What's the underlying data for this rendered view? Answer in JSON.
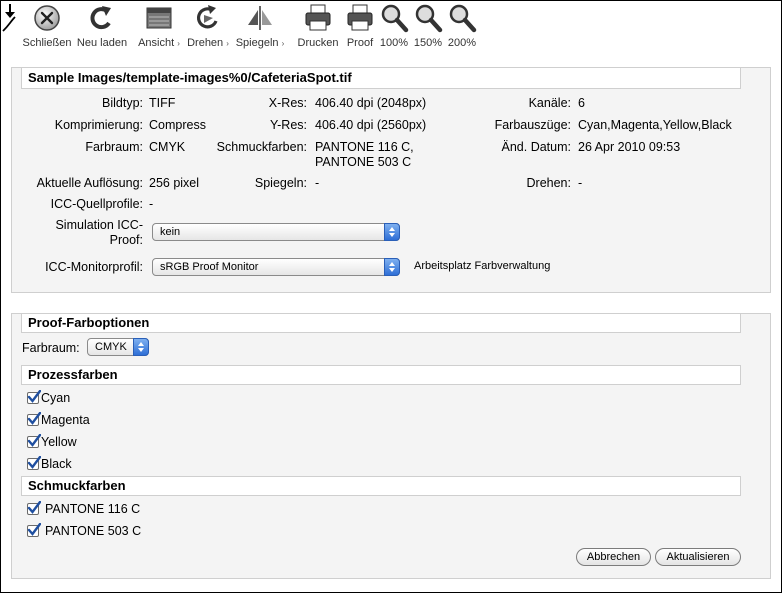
{
  "toolbar": {
    "items": [
      {
        "label": "Schließen",
        "icon": "close-icon",
        "dropdown": false
      },
      {
        "label": "Neu laden",
        "icon": "reload-icon",
        "dropdown": false
      },
      {
        "label": "Ansicht",
        "icon": "view-icon",
        "dropdown": true
      },
      {
        "label": "Drehen",
        "icon": "rotate-icon",
        "dropdown": true
      },
      {
        "label": "Spiegeln",
        "icon": "mirror-icon",
        "dropdown": true
      },
      {
        "label": "Drucken",
        "icon": "printer-icon",
        "dropdown": false
      },
      {
        "label": "Proof",
        "icon": "proof-printer-icon",
        "dropdown": false
      },
      {
        "label": "100%",
        "icon": "zoom-icon",
        "dropdown": false
      },
      {
        "label": "150%",
        "icon": "zoom-icon",
        "dropdown": false
      },
      {
        "label": "200%",
        "icon": "zoom-icon",
        "dropdown": false
      }
    ],
    "dropdown_arrow": "›"
  },
  "info": {
    "title": "Sample Images/template-images%0/CafeteriaSpot.tif",
    "bildtyp_label": "Bildtyp:",
    "bildtyp_value": "TIFF",
    "xres_label": "X-Res:",
    "xres_value": "406.40 dpi (2048px)",
    "kanaele_label": "Kanäle:",
    "kanaele_value": "6",
    "kompr_label": "Komprimierung:",
    "kompr_value": "Compress",
    "yres_label": "Y-Res:",
    "yres_value": "406.40 dpi (2560px)",
    "farbauszuege_label": "Farbauszüge:",
    "farbauszuege_value": "Cyan,Magenta,Yellow,Black",
    "farbraum_label": "Farbraum:",
    "farbraum_value": "CMYK",
    "schmuck_label": "Schmuckfarben:",
    "schmuck_value_1": "PANTONE 116 C,",
    "schmuck_value_2": "PANTONE 503 C",
    "aend_label": "Änd. Datum:",
    "aend_value": "26 Apr 2010 09:53",
    "aufl_label": "Aktuelle Auflösung:",
    "aufl_value": "256 pixel",
    "spiegeln_label": "Spiegeln:",
    "spiegeln_value": "-",
    "drehen_label": "Drehen:",
    "drehen_value": "-",
    "icc_quell_label": "ICC-Quellprofile:",
    "icc_quell_value": "-",
    "sim_label_1": "Simulation ICC-",
    "sim_label_2": "Proof:",
    "sim_select": "kein",
    "monitor_label": "ICC-Monitorprofil:",
    "monitor_select": "sRGB Proof Monitor",
    "monitor_note": "Arbeitsplatz Farbverwaltung"
  },
  "proof": {
    "title": "Proof-Farboptionen",
    "farbraum_label": "Farbraum:",
    "farbraum_select": "CMYK",
    "prozess_title": "Prozessfarben",
    "prozess": [
      {
        "label": "Cyan",
        "checked": true
      },
      {
        "label": "Magenta",
        "checked": true
      },
      {
        "label": "Yellow",
        "checked": true
      },
      {
        "label": "Black",
        "checked": true
      }
    ],
    "schmuck_title": "Schmuckfarben",
    "schmuck": [
      {
        "label": "PANTONE 116 C",
        "checked": true
      },
      {
        "label": "PANTONE 503 C",
        "checked": true
      }
    ],
    "cancel_label": "Abbrechen",
    "update_label": "Aktualisieren"
  },
  "colors": {
    "accent": "#2f6fd6",
    "check": "#1f4fa0",
    "panel_bg": "#f4f4f4"
  }
}
